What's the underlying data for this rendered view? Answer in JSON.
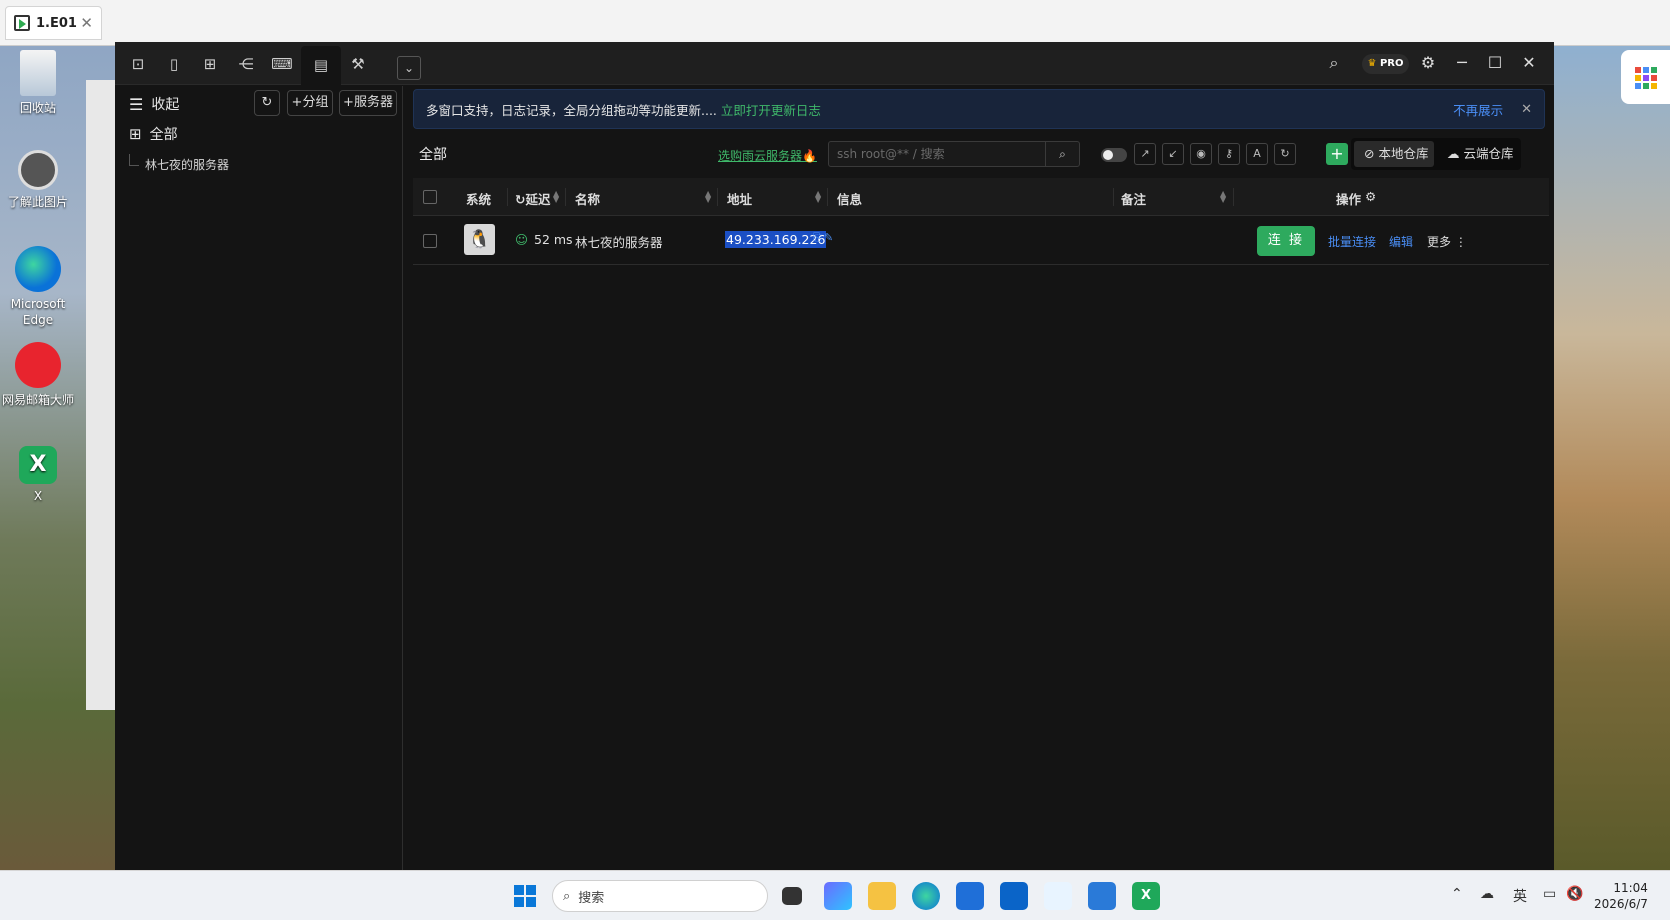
{
  "outer_tab": {
    "title": "1.E01",
    "close": "✕"
  },
  "desktop": {
    "icons": [
      {
        "label": "回收站"
      },
      {
        "label": "了解此图片"
      },
      {
        "label": "Microsoft Edge"
      },
      {
        "label": "网易邮箱大师"
      },
      {
        "label": "X"
      }
    ]
  },
  "app": {
    "toolbar_tabs": [
      "terminal",
      "file",
      "grid",
      "tree",
      "console",
      "server-list",
      "tools"
    ],
    "pro_badge": "PRO",
    "sidebar": {
      "collapse_label": "收起",
      "add_group_label": "+分组",
      "add_server_label": "+服务器",
      "all_label": "全部",
      "items": [
        {
          "label": "林七夜的服务器"
        }
      ]
    },
    "notice": {
      "text": "多窗口支持，日志记录，全局分组拖动等功能更新....",
      "link": "立即打开更新日志",
      "dismiss": "不再展示",
      "close": "✕"
    },
    "toolbar": {
      "title": "全部",
      "buy_link": "选购雨云服务器🔥",
      "search_placeholder": "ssh root@** / 搜索",
      "local_repo": "本地仓库",
      "cloud_repo": "云端仓库"
    },
    "table": {
      "headers": {
        "system": "系统",
        "latency": "延迟",
        "name": "名称",
        "address": "地址",
        "info": "信息",
        "remark": "备注",
        "actions": "操作"
      },
      "rows": [
        {
          "latency": "52 ms",
          "name": "林七夜的服务器",
          "address": "49.233.169.226",
          "info": "",
          "remark": "",
          "connect": "连 接",
          "batch": "批量连接",
          "edit": "编辑",
          "more": "更多 ⋮"
        }
      ]
    }
  },
  "taskbar": {
    "search_label": "搜索",
    "lang": "英",
    "time": "11:04",
    "date": "2026/6/7"
  },
  "colors": {
    "accent_green": "#2eaa5e",
    "link_blue": "#4a8ef5",
    "selection_blue": "#1b4fc4"
  }
}
